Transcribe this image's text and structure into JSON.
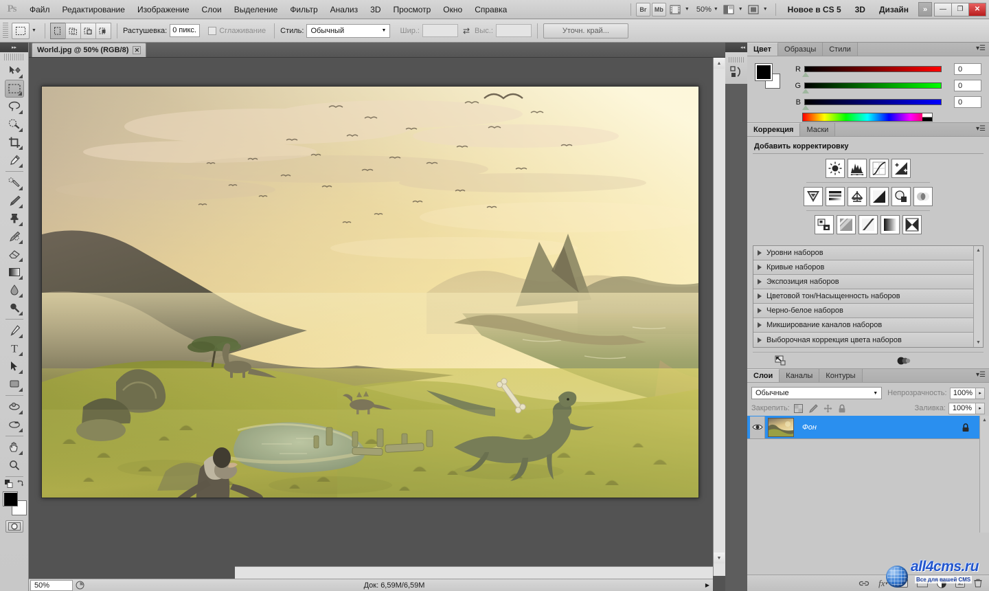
{
  "app": {
    "logo": "Ps",
    "menu": [
      "Файл",
      "Редактирование",
      "Изображение",
      "Слои",
      "Выделение",
      "Фильтр",
      "Анализ",
      "3D",
      "Просмотр",
      "Окно",
      "Справка"
    ],
    "quick_buttons": [
      {
        "name": "bridge",
        "label": "Br"
      },
      {
        "name": "mini-bridge",
        "label": "Mb"
      }
    ],
    "view_extras_label": "",
    "zoom_level": "50%",
    "workspaces": [
      "Новое в CS 5",
      "3D",
      "Дизайн"
    ],
    "more_workspaces": "»",
    "window_buttons": {
      "minimize": "—",
      "restore": "❐",
      "close": "✕"
    }
  },
  "options_bar": {
    "feather_label": "Растушевка:",
    "feather_value": "0 пикс.",
    "antialias_label": "Сглаживание",
    "style_label": "Стиль:",
    "style_value": "Обычный",
    "width_label": "Шир.:",
    "width_value": "",
    "height_label": "Выс.:",
    "height_value": "",
    "refine_edge_label": "Уточн. край..."
  },
  "toolbar": {
    "tools": [
      {
        "name": "move-tool",
        "label": "Перемещение"
      },
      {
        "name": "rectangular-marquee-tool",
        "label": "Прямоугольная область",
        "active": true
      },
      {
        "name": "lasso-tool",
        "label": "Лассо"
      },
      {
        "name": "quick-selection-tool",
        "label": "Быстрое выделение"
      },
      {
        "name": "crop-tool",
        "label": "Рамка"
      },
      {
        "name": "eyedropper-tool",
        "label": "Пипетка"
      },
      {
        "name": "healing-brush-tool",
        "label": "Восстанавливающая кисть"
      },
      {
        "name": "brush-tool",
        "label": "Кисть"
      },
      {
        "name": "clone-stamp-tool",
        "label": "Штамп"
      },
      {
        "name": "history-brush-tool",
        "label": "Архивная кисть"
      },
      {
        "name": "eraser-tool",
        "label": "Ластик"
      },
      {
        "name": "gradient-tool",
        "label": "Градиент"
      },
      {
        "name": "blur-tool",
        "label": "Размытие"
      },
      {
        "name": "dodge-tool",
        "label": "Осветлитель"
      },
      {
        "name": "pen-tool",
        "label": "Перо"
      },
      {
        "name": "type-tool",
        "label": "Текст"
      },
      {
        "name": "path-selection-tool",
        "label": "Выделение контура"
      },
      {
        "name": "rectangle-shape-tool",
        "label": "Прямоугольник"
      },
      {
        "name": "rotate-3d-object-tool",
        "label": "Поворот 3D-объекта"
      },
      {
        "name": "rotate-3d-camera-tool",
        "label": "Поворот 3D-камеры"
      },
      {
        "name": "hand-tool",
        "label": "Рука"
      },
      {
        "name": "zoom-tool",
        "label": "Масштаб"
      }
    ],
    "foreground_color": "#000000",
    "background_color": "#ffffff",
    "quick_mask_label": "Быстрая маска"
  },
  "document": {
    "tab_title": "World.jpg @ 50% (RGB/8)",
    "close_glyph": "✕",
    "status_zoom": "50%",
    "status_info": "Док: 6,59M/6,59M"
  },
  "color_panel": {
    "tabs": [
      "Цвет",
      "Образцы",
      "Стили"
    ],
    "selected_tab": "Цвет",
    "channels": [
      {
        "label": "R",
        "value": "0"
      },
      {
        "label": "G",
        "value": "0"
      },
      {
        "label": "B",
        "value": "0"
      }
    ]
  },
  "adjustments_panel": {
    "tabs": [
      "Коррекция",
      "Маски"
    ],
    "selected_tab": "Коррекция",
    "title": "Добавить корректировку",
    "buttons_row1": [
      "brightness-contrast-icon",
      "levels-icon",
      "curves-icon",
      "exposure-icon"
    ],
    "buttons_row2": [
      "vibrance-icon",
      "hue-saturation-icon",
      "color-balance-icon",
      "black-white-icon",
      "photo-filter-icon",
      "channel-mixer-icon"
    ],
    "buttons_row3": [
      "invert-icon",
      "posterize-icon",
      "threshold-icon",
      "gradient-map-icon",
      "selective-color-icon"
    ],
    "presets": [
      "Уровни наборов",
      "Кривые наборов",
      "Экспозиция наборов",
      "Цветовой тон/Насыщенность наборов",
      "Черно-белое наборов",
      "Микширование каналов наборов",
      "Выборочная коррекция цвета наборов"
    ],
    "footer_icons": [
      "clip-to-layer-icon",
      "toggle-visibility-icon"
    ]
  },
  "layers_panel": {
    "tabs": [
      "Слои",
      "Каналы",
      "Контуры"
    ],
    "selected_tab": "Слои",
    "blend_mode": "Обычные",
    "opacity_label": "Непрозрачность:",
    "opacity_value": "100%",
    "lock_label": "Закрепить:",
    "fill_label": "Заливка:",
    "fill_value": "100%",
    "lock_icons": [
      "lock-transparency-icon",
      "lock-image-icon",
      "lock-position-icon",
      "lock-all-icon"
    ],
    "layers": [
      {
        "name": "Фон",
        "visible": true,
        "locked": true,
        "selected": true
      }
    ],
    "footer_icons": [
      "link-layers-icon",
      "layer-style-fx-icon",
      "layer-mask-icon",
      "new-group-icon",
      "new-adjustment-icon",
      "new-layer-icon",
      "delete-layer-icon"
    ]
  },
  "watermark": {
    "site": "all4cms.ru",
    "tagline": "Все для вашей CMS",
    "icon": "globe-icon",
    "color": "#2255cc"
  },
  "colors": {
    "chrome": "#c8c8c8",
    "canvas_bg": "#535353",
    "selection_blue": "#2a8fef",
    "close_red": "#b81d1d"
  }
}
